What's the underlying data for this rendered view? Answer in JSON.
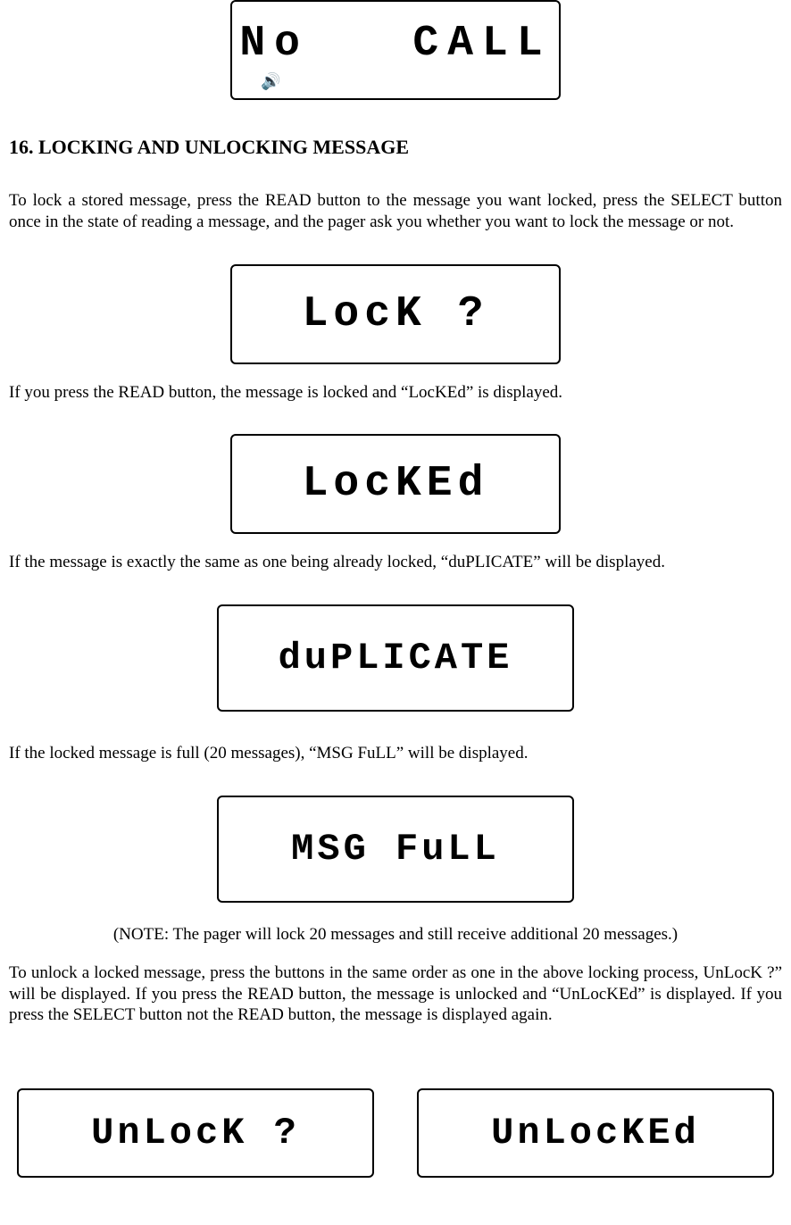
{
  "lcd": {
    "no_call": "No   CALL",
    "lock_q": "LocK ?",
    "locked": "LocKEd",
    "duplicate": "duPLICATE",
    "msg_full": "MSG FuLL",
    "unlock_q": "UnLocK ?",
    "unlocked": "UnLocKEd",
    "speaker": "🔊"
  },
  "heading": "16. LOCKING AND UNLOCKING MESSAGE",
  "para1": "To lock a stored message, press the READ button to the message you want locked, press the SELECT button once in the state of reading a message, and the pager ask you whether you want to lock the message or not.",
  "para2": " If you press the READ button, the message is locked and “LocKEd” is displayed.",
  "para3": "If the message is exactly the same as one being already locked, “duPLICATE” will be displayed.",
  "para4": " If the locked message is full (20 messages), “MSG FuLL” will be displayed.",
  "note": "(NOTE: The pager will lock 20 messages and still receive additional 20 messages.)",
  "para5": "To unlock a locked message, press the buttons in the same order as one in the above locking process, UnLocK ?” will be displayed. If you press the READ button, the message is unlocked and “UnLocKEd” is displayed. If you press the SELECT button not the READ button, the message is displayed again."
}
